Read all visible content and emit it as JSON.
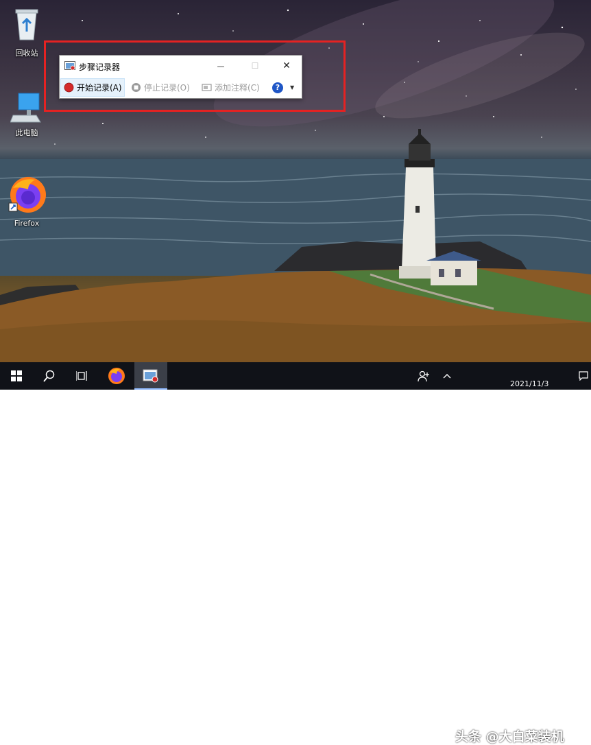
{
  "desktop": {
    "icons": [
      {
        "label": "回收站",
        "icon": "recycle-bin-icon"
      },
      {
        "label": "此电脑",
        "icon": "computer-icon"
      },
      {
        "label": "Firefox",
        "icon": "firefox-icon"
      }
    ]
  },
  "window": {
    "title": "步骤记录器",
    "controls": {
      "minimize": "—",
      "maximize": "☐",
      "close": "✕"
    },
    "toolbar": {
      "start_record": "开始记录(A)",
      "stop_record": "停止记录(O)",
      "add_comment": "添加注释(C)",
      "help": "?",
      "dropdown": "▼"
    }
  },
  "taskbar": {
    "clock_date": "2021/11/3",
    "watermark": "头条 @大白菜装机"
  },
  "colors": {
    "highlight": "#e52222",
    "record_red": "#d42a2a",
    "taskbar": "#101218"
  }
}
